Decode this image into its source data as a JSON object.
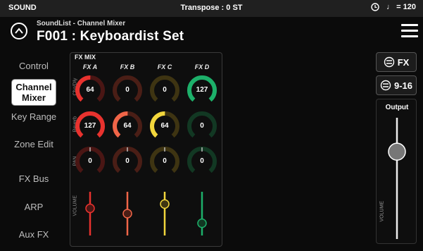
{
  "status_bar": {
    "section": "SOUND",
    "transpose": "Transpose : 0 ST",
    "tempo": "♩ = 120"
  },
  "header": {
    "subtitle": "SoundList - Channel Mixer",
    "title": "F001 : Keyboardist Set"
  },
  "sidebar": {
    "items": [
      {
        "label": "Control",
        "active": false
      },
      {
        "label": "Channel Mixer",
        "active": true
      },
      {
        "label": "Key Range",
        "active": false
      },
      {
        "label": "Zone Edit",
        "active": false
      },
      {
        "label": "FX Bus",
        "active": false
      },
      {
        "label": "ARP",
        "active": false
      },
      {
        "label": "Aux FX",
        "active": false
      }
    ]
  },
  "fx_mix": {
    "title": "FX MIX",
    "columns": [
      {
        "label": "FX A",
        "color": "#e8322e",
        "dim": "#4a1614"
      },
      {
        "label": "FX B",
        "color": "#f06548",
        "dim": "#4a1e16"
      },
      {
        "label": "FX C",
        "color": "#f2d63c",
        "dim": "#3e3412"
      },
      {
        "label": "FX D",
        "color": "#1db06a",
        "dim": "#123823"
      }
    ],
    "rows": [
      {
        "label": "Cho/Dly",
        "values": [
          "64",
          "0",
          "0",
          "127"
        ]
      },
      {
        "label": "Reverb",
        "values": [
          "127",
          "64",
          "64",
          "0"
        ]
      },
      {
        "label": "PAN",
        "values": [
          "0",
          "0",
          "0",
          "0"
        ]
      }
    ],
    "volume_label": "VOLUME",
    "volume_levels": [
      0.62,
      0.5,
      0.72,
      0.28
    ]
  },
  "right_panel": {
    "fx_button": "FX",
    "range_button": "9-16",
    "output_title": "Output",
    "output_volume_label": "VOLUME",
    "output_level": 0.72
  }
}
